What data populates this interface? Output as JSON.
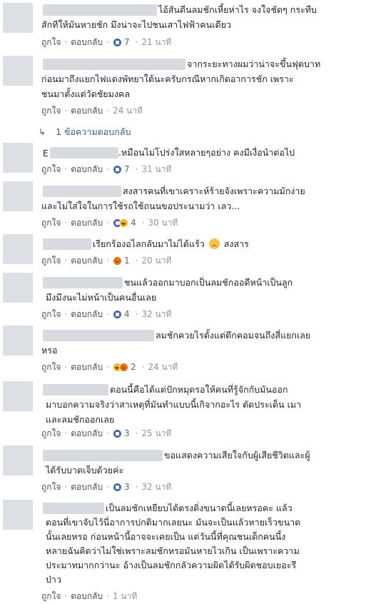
{
  "actions": {
    "like": "ถูกใจ",
    "reply": "ตอบกลับ",
    "sep": "·"
  },
  "reply_summary": "1 ข้อความตอบกลับ",
  "comments": [
    {
      "lines": [
        "ไอ้สันดีนลมชักเหี้ยห่าไร จงใจชัดๆ กระทืบ",
        "สักทีให้มันหายชัก มึงน่าจะไปชนเสาไฟฟ้าคนเดียว"
      ],
      "reactions": "7",
      "time": "21 นาที"
    },
    {
      "lines": [
        "จากระยะทางผมว่าน่าจะขึ้นฟุตบาท",
        "ก่อนมาถึงแยกไฟแดงพัทยาใต้นะครับกรณีหากเกิดอาการชัก เพราะ",
        "ชนมาตั้งแต่วัดชัยมงคล"
      ],
      "reactions": "",
      "time": "24 นาที"
    },
    {
      "initial": "E",
      "lines": [
        ".หมือนไม่โปร่งใสหลายๆอย่าง คงมีเงื่อนำต่อไป"
      ],
      "reactions": "7",
      "time": "31 นาที"
    },
    {
      "lines": [
        "สงสารคนที่เขาเคราะห์ร้ายจังเพราะความมักง่าย",
        "และไม่ใส่ใจในการใช้รถใช้ถนนขอประนามว่า เลว..."
      ],
      "reactions": "4",
      "time": "30 นาที"
    },
    {
      "lines": [
        "เรียกร้องอไลกลับมาไม่ได้แร้ว",
        "สงสาร"
      ],
      "reactions": "1",
      "time": "20 นาที"
    },
    {
      "lines": [
        "ชนแล้วออกมาบอกเป็นลมชักออดีหน้าเป็นลูก",
        "มึงมึงนะไม่หน้าเป็นคนอื่นเลย"
      ],
      "reactions": "4",
      "time": "32 นาที"
    },
    {
      "lines": [
        "ลมชักควยไรตั้งแต่ตึกคอมจนถึงสี่แยกเลย",
        "หรอ"
      ],
      "reactions": "2",
      "time": "24 นาที"
    },
    {
      "lines": [
        "ตอนนี้คือได้แต่ปักหมุดรอให้คนที่รู้จักกับมันออก",
        "มาบอกความจริงว่าสาเหตุที่มันทำแบบนี้เกิจากอะไร ตัดประเด็น เมา",
        "และลมชักออกเลย"
      ],
      "reactions": "3",
      "time": "25 นาที"
    },
    {
      "lines": [
        "ขอแสดงความเสียใจกับผู้เสียชีวิตและผู้",
        "ได้รับบาดเจ็บด้วยค่ะ"
      ],
      "reactions": "3",
      "time": "32 นาที"
    },
    {
      "lines": [
        "เป็นลมชักเหยียบได้ตรงดิ่งขนาดนี้เลยหรอคะ แล้ว",
        "ตอนที่เขาจับไว้นี่อาการปกติมากเลยนะ มันจะเป็นแล้วหายเร็วขนาด",
        "นั้นเลยหรอ ก่อนหน้านี้อาจจะเคยเป็น แต่วันนี้ที่คุณชนเด็กคนนึ้ง",
        "หลายฉันคิดว่าไม่ใช่เพราะลมชักหรอมันหายไวเกิน เป็นเพราะความ",
        "ประมาทมากกว่านะ อ้างเป็นลมชักกลัวความผิดได้รับผิดชอบเยอะรึ",
        "ป่าว"
      ],
      "reactions": "",
      "time": "1 นาที"
    }
  ]
}
